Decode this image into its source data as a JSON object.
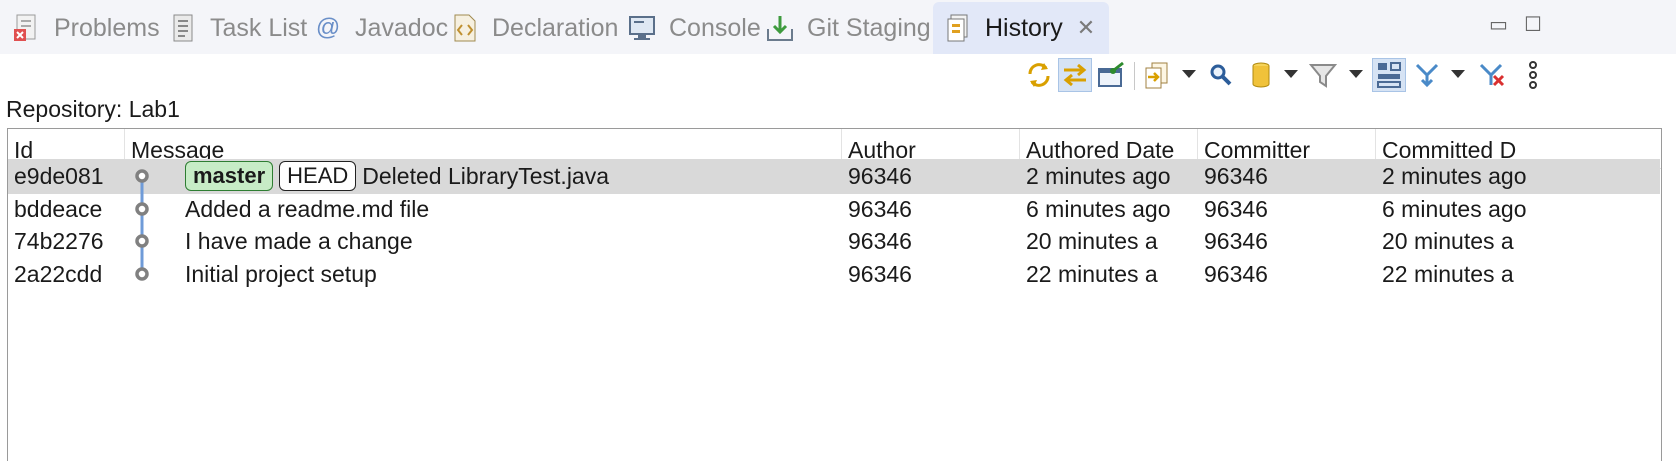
{
  "tabs": [
    {
      "id": "problems",
      "label": "Problems",
      "icon": "problems-icon"
    },
    {
      "id": "tasklist",
      "label": "Task List",
      "icon": "task-list-icon"
    },
    {
      "id": "javadoc",
      "label": "Javadoc",
      "icon": "at-sign-icon"
    },
    {
      "id": "declaration",
      "label": "Declaration",
      "icon": "declaration-icon"
    },
    {
      "id": "console",
      "label": "Console",
      "icon": "console-icon"
    },
    {
      "id": "gitstaging",
      "label": "Git Staging",
      "icon": "git-staging-icon"
    },
    {
      "id": "history",
      "label": "History",
      "icon": "history-icon",
      "active": true
    }
  ],
  "window_controls": {
    "minimize": "▭",
    "maximize": "☐"
  },
  "toolbar": {
    "buttons": [
      "sync-icon",
      "link-with-selection-icon",
      "pin-icon",
      "compare-mode-icon",
      "search-icon",
      "repository-icon",
      "filter-icon",
      "show-all-branches-icon",
      "merge-icon",
      "remove-icon",
      "more-icon"
    ]
  },
  "repository": {
    "label": "Repository: Lab1"
  },
  "table": {
    "columns": [
      "Id",
      "Message",
      "Author",
      "Authored Date",
      "Committer",
      "Committed D"
    ],
    "rows": [
      {
        "id": "e9de081",
        "refs": [
          "master",
          "HEAD"
        ],
        "message": "Deleted LibraryTest.java",
        "author": "96346",
        "authored": "2 minutes ago",
        "committer": "96346",
        "committed": "2 minutes ago",
        "selected": true
      },
      {
        "id": "bddeace",
        "refs": [],
        "message": "Added a readme.md file",
        "author": "96346",
        "authored": "6 minutes ago",
        "committer": "96346",
        "committed": "6 minutes ago"
      },
      {
        "id": "74b2276",
        "refs": [],
        "message": "I have made a change",
        "author": "96346",
        "authored": "20 minutes a",
        "committer": "96346",
        "committed": "20 minutes a"
      },
      {
        "id": "2a22cdd",
        "refs": [],
        "message": "Initial project setup",
        "author": "96346",
        "authored": "22 minutes a",
        "committer": "96346",
        "committed": "22 minutes a"
      }
    ]
  },
  "colors": {
    "graph_line": "#6f9bd8",
    "graph_node": "#808080",
    "branch_bg": "#c7ecc6",
    "branch_border": "#2e7d32",
    "selected_row": "#d9d9d9"
  }
}
